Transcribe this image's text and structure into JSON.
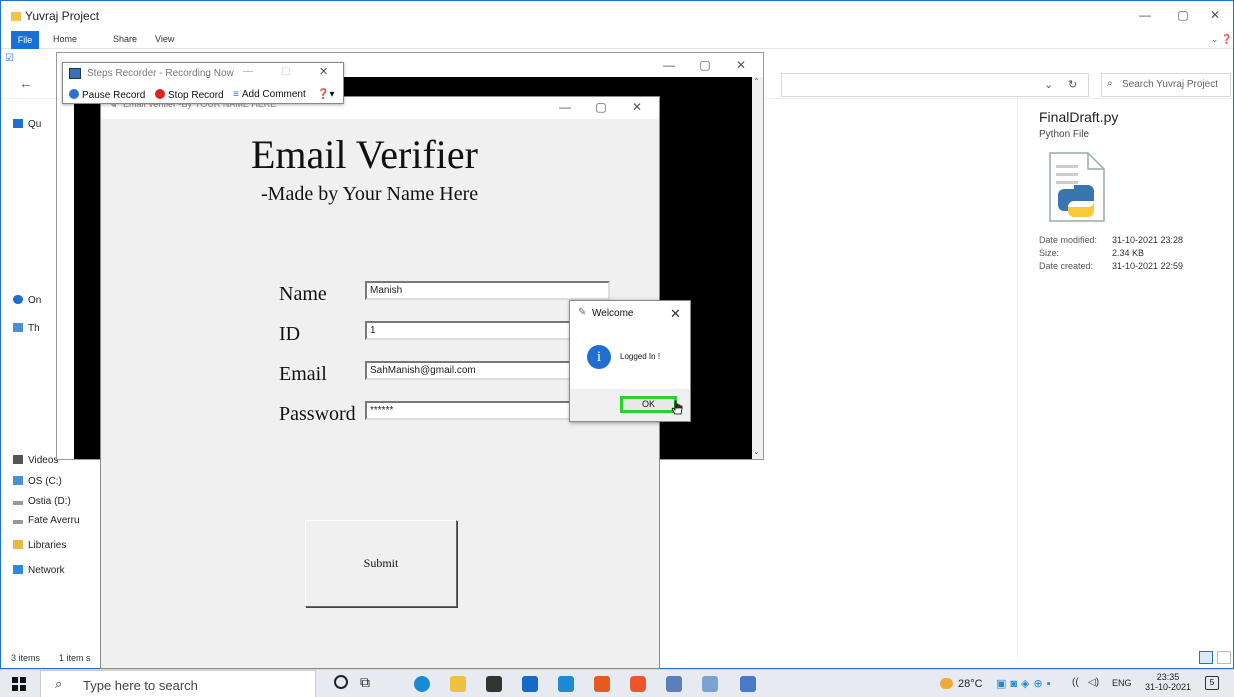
{
  "explorer": {
    "title": "Yuvraj Project",
    "ribbon_file": "File",
    "ribbon_home": "Home",
    "ribbon_share": "Share",
    "ribbon_view": "View",
    "search_placeholder": "Search Yuvraj Project",
    "nav": {
      "onedrive": "On",
      "thispc": "Th",
      "videos": "Videos",
      "os_c": "OS (C:)",
      "ostia_d": "Ostia (D:)",
      "fate": "Fate Averru",
      "libraries": "Libraries",
      "network": "Network"
    },
    "details": {
      "file_name": "FinalDraft.py",
      "file_type": "Python File",
      "date_modified_label": "Date modified:",
      "date_modified": "31-10-2021 23:28",
      "size_label": "Size:",
      "size": "2.34 KB",
      "date_created_label": "Date created:",
      "date_created": "31-10-2021 22:59"
    },
    "status_items": "3 items",
    "status_selected": "1 item s"
  },
  "steps_recorder": {
    "title": "Steps Recorder - Recording Now",
    "pause": "Pause Record",
    "stop": "Stop Record",
    "comment": "Add Comment"
  },
  "email_verifier": {
    "window_title": "Email Verifier -By YOUR NAME HERE",
    "heading": "Email Verifier",
    "subheading": "-Made by Your Name Here",
    "name_label": "Name",
    "name_value": "Manish",
    "id_label": "ID",
    "id_value": "1",
    "email_label": "Email",
    "email_value": "SahManish@gmail.com",
    "password_label": "Password",
    "password_value": "******",
    "submit_label": "Submit"
  },
  "dialog": {
    "title": "Welcome",
    "message": "Logged In !",
    "ok_label": "OK"
  },
  "taskbar": {
    "search_placeholder": "Type here to search",
    "temperature": "28°C",
    "language": "ENG",
    "time": "23:35",
    "date": "31-10-2021"
  }
}
